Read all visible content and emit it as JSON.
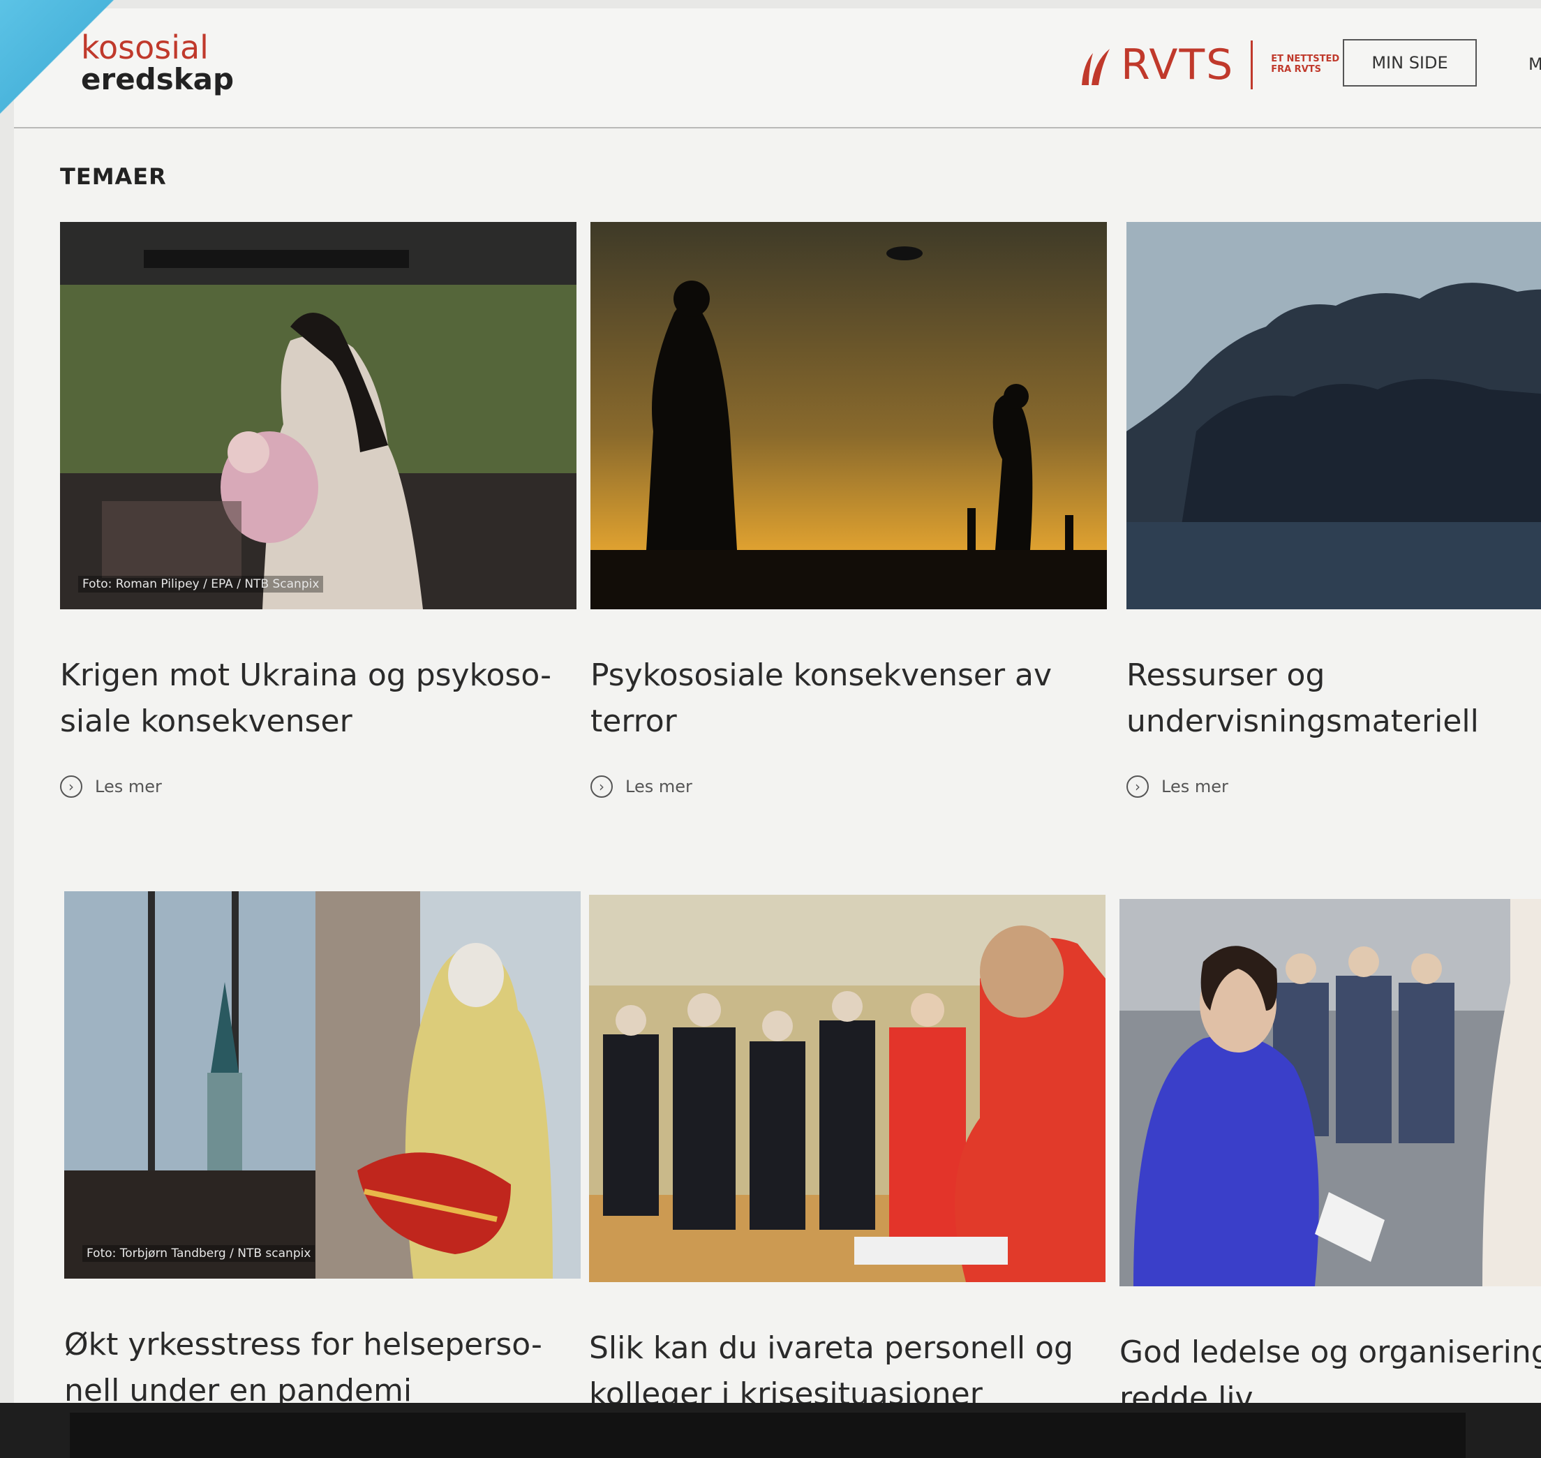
{
  "header": {
    "site_title_line1": "kososial",
    "site_title_line2": "eredskap",
    "partner_logo": "RVTS",
    "partner_tag_line1": "ET NETTSTED",
    "partner_tag_line2": "FRA RVTS",
    "min_side_button": "MIN SIDE",
    "cut_menu_letter": "M"
  },
  "section": {
    "title": "TEMAER"
  },
  "cards": [
    {
      "title": "Krigen mot Ukraina og psykoso-siale konsekvenser",
      "title_l1": "Krigen mot Ukraina og psykoso-",
      "title_l2": "siale konsekvenser",
      "credit": "Foto: Roman Pilipey / EPA / NTB Scanpix",
      "link": "Les mer"
    },
    {
      "title": "Psykososiale konsekvenser av terror",
      "title_l1": "Psykososiale konsekvenser av",
      "title_l2": "terror",
      "credit": "",
      "link": "Les mer"
    },
    {
      "title": "Ressurser og undervisningsmateriell",
      "title_l1": "Ressurser og",
      "title_l2": "undervisningsmateriell",
      "credit": "",
      "link": "Les mer"
    },
    {
      "title": "Økt yrkesstress for helseperso-nell under en pandemi",
      "title_l1": "Økt yrkesstress for helseperso-",
      "title_l2": "nell under en pandemi",
      "credit": "Foto: Torbjørn Tandberg / NTB scanpix",
      "link": ""
    },
    {
      "title": "Slik kan du ivareta personell og kolleger i krisesituasjoner",
      "title_l1": "Slik kan du ivareta personell og",
      "title_l2": "kolleger i krisesituasjoner",
      "credit": "",
      "link": ""
    },
    {
      "title": "God ledelse og organisering redde liv",
      "title_l1": "God ledelse og organisering",
      "title_l2": "redde liv",
      "credit": "",
      "link": ""
    }
  ],
  "colors": {
    "brand_red": "#c0392b",
    "text": "#2a2a2a",
    "background": "#f3f3f1"
  },
  "icons": {
    "read_more": "chevron-circle-right-icon"
  }
}
